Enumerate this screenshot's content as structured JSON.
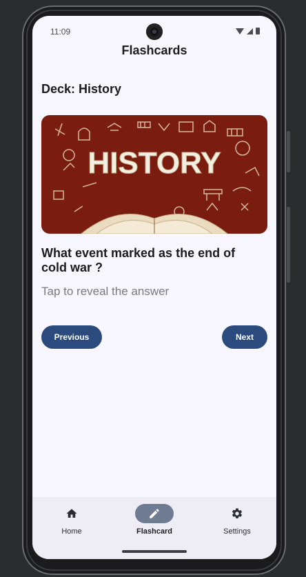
{
  "status": {
    "time": "11:09"
  },
  "app": {
    "title": "Flashcards"
  },
  "deck": {
    "label": "Deck: History"
  },
  "hero": {
    "banner_text": "HISTORY"
  },
  "card": {
    "question": "What event marked as the end of cold war ?",
    "reveal_hint": "Tap to reveal the answer"
  },
  "buttons": {
    "previous": "Previous",
    "next": "Next"
  },
  "nav": {
    "items": [
      {
        "label": "Home",
        "icon": "home-icon"
      },
      {
        "label": "Flashcard",
        "icon": "edit-icon",
        "active": true
      },
      {
        "label": "Settings",
        "icon": "gear-icon"
      }
    ]
  },
  "colors": {
    "accent": "#2b4a7e",
    "hero_bg": "#7a1c10",
    "screen_bg": "#f8f6fe",
    "nav_bg": "#eeedf6"
  }
}
